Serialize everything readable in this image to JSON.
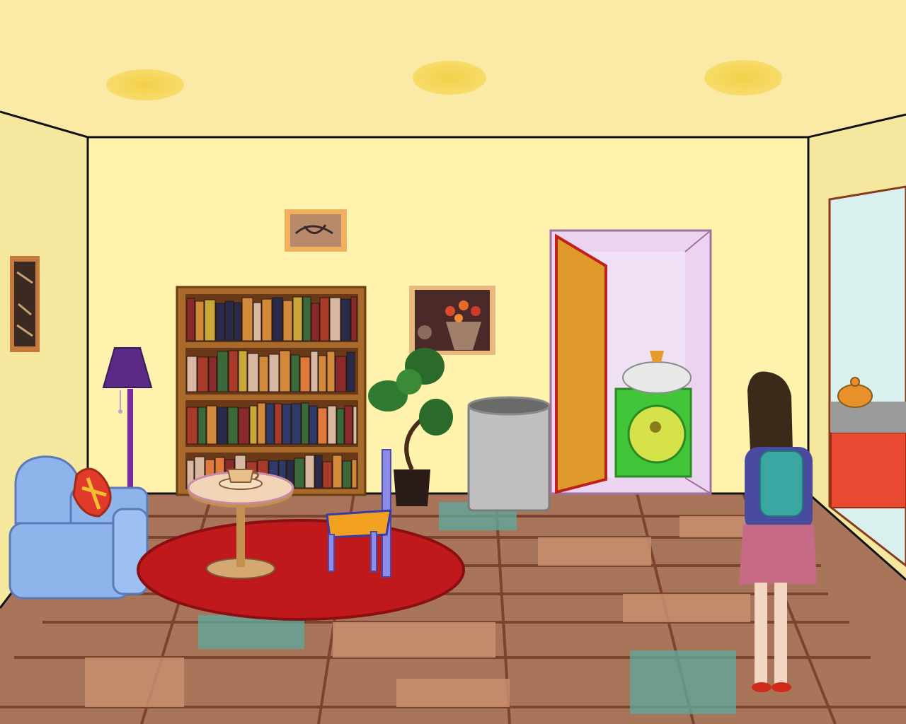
{
  "scene": {
    "name": "living-room",
    "colors": {
      "ceiling": "#fbeaa6",
      "back_wall": "#fff3ad",
      "side_wall": "#f6e79e",
      "floor_base": "#a8755b",
      "floor_light": "#c98e70",
      "floor_teal": "#5fa89a",
      "rug": "#c0191b",
      "sofa": "#8fb4ec",
      "lamp_shade": "#5a2a86",
      "lamp_pole": "#7a2aa0",
      "bookshelf": "#a76a2a",
      "table_top": "#f1d5b6",
      "chair": "#8c8ce8",
      "bin": "#bfbfbf",
      "door": "#e09a2c",
      "door_frame": "#ecd4f0",
      "sink_cabinet": "#43c53a",
      "kitchen_counter": "#e84a32",
      "kitchen_wall": "#d8f0ee",
      "girl_shirt": "#4a4a9e",
      "girl_skirt": "#c76a86",
      "girl_backpack": "#3aa7a2",
      "girl_hair": "#3b2a1a"
    },
    "objects": [
      {
        "id": "ceiling-light",
        "count": 3
      },
      {
        "id": "bookshelf",
        "shelves": 4
      },
      {
        "id": "floor-lamp"
      },
      {
        "id": "sofa"
      },
      {
        "id": "cushion"
      },
      {
        "id": "round-rug"
      },
      {
        "id": "side-table"
      },
      {
        "id": "teacup"
      },
      {
        "id": "chair"
      },
      {
        "id": "potted-plant"
      },
      {
        "id": "trash-bin"
      },
      {
        "id": "bathroom-door"
      },
      {
        "id": "sink"
      },
      {
        "id": "kitchen-doorway"
      },
      {
        "id": "kettle"
      },
      {
        "id": "girl-character"
      },
      {
        "id": "wall-painting",
        "count": 3
      }
    ]
  }
}
